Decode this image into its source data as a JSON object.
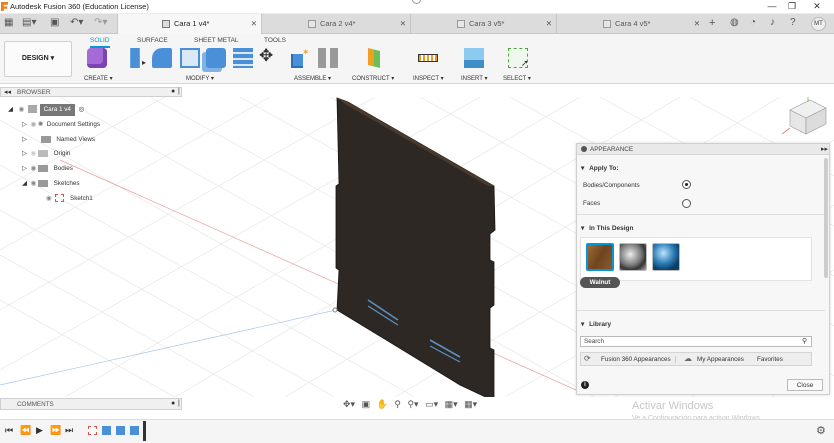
{
  "window": {
    "title": "Autodesk Fusion 360 (Education License)",
    "controls": [
      "—",
      "❐",
      "✕"
    ]
  },
  "tabs": [
    {
      "label": "Cara 1 v4*",
      "active": true
    },
    {
      "label": "Cara 2 v4*",
      "active": false
    },
    {
      "label": "Cara 3 v5*",
      "active": false
    },
    {
      "label": "Cara 4 v5*",
      "active": false
    }
  ],
  "user": {
    "initials": "MT"
  },
  "ribbon": {
    "workspace": "DESIGN",
    "tabs": [
      "SOLID",
      "SURFACE",
      "SHEET METAL",
      "TOOLS"
    ],
    "groups": [
      "CREATE",
      "MODIFY",
      "ASSEMBLE",
      "CONSTRUCT",
      "INSPECT",
      "INSERT",
      "SELECT"
    ]
  },
  "browser": {
    "title": "BROWSER",
    "root": "Cara 1 v4",
    "items": [
      "Document Settings",
      "Named Views",
      "Origin",
      "Bodies",
      "Sketches",
      "Sketch1"
    ]
  },
  "appearance": {
    "title": "APPEARANCE",
    "apply_to_label": "Apply To:",
    "option_bodies": "Bodies/Components",
    "option_faces": "Faces",
    "in_design_label": "In This Design",
    "selected_material": "Walnut",
    "library_label": "Library",
    "search_placeholder": "Search",
    "lib_tab_fusion": "Fusion 360 Appearances",
    "lib_tab_my": "My Appearances",
    "lib_tab_fav": "Favorites",
    "close_label": "Close",
    "colors": {
      "walnut": "#8b5a2b",
      "steel": "#9a9a9a",
      "blue": "#2d7fb8"
    }
  },
  "comments": {
    "label": "COMMENTS"
  },
  "watermark": {
    "line1": "Activar Windows",
    "line2": "Ve a Configuración para activar Windows."
  },
  "colors": {
    "accent": "#0696d7",
    "board": "#2e2824"
  }
}
